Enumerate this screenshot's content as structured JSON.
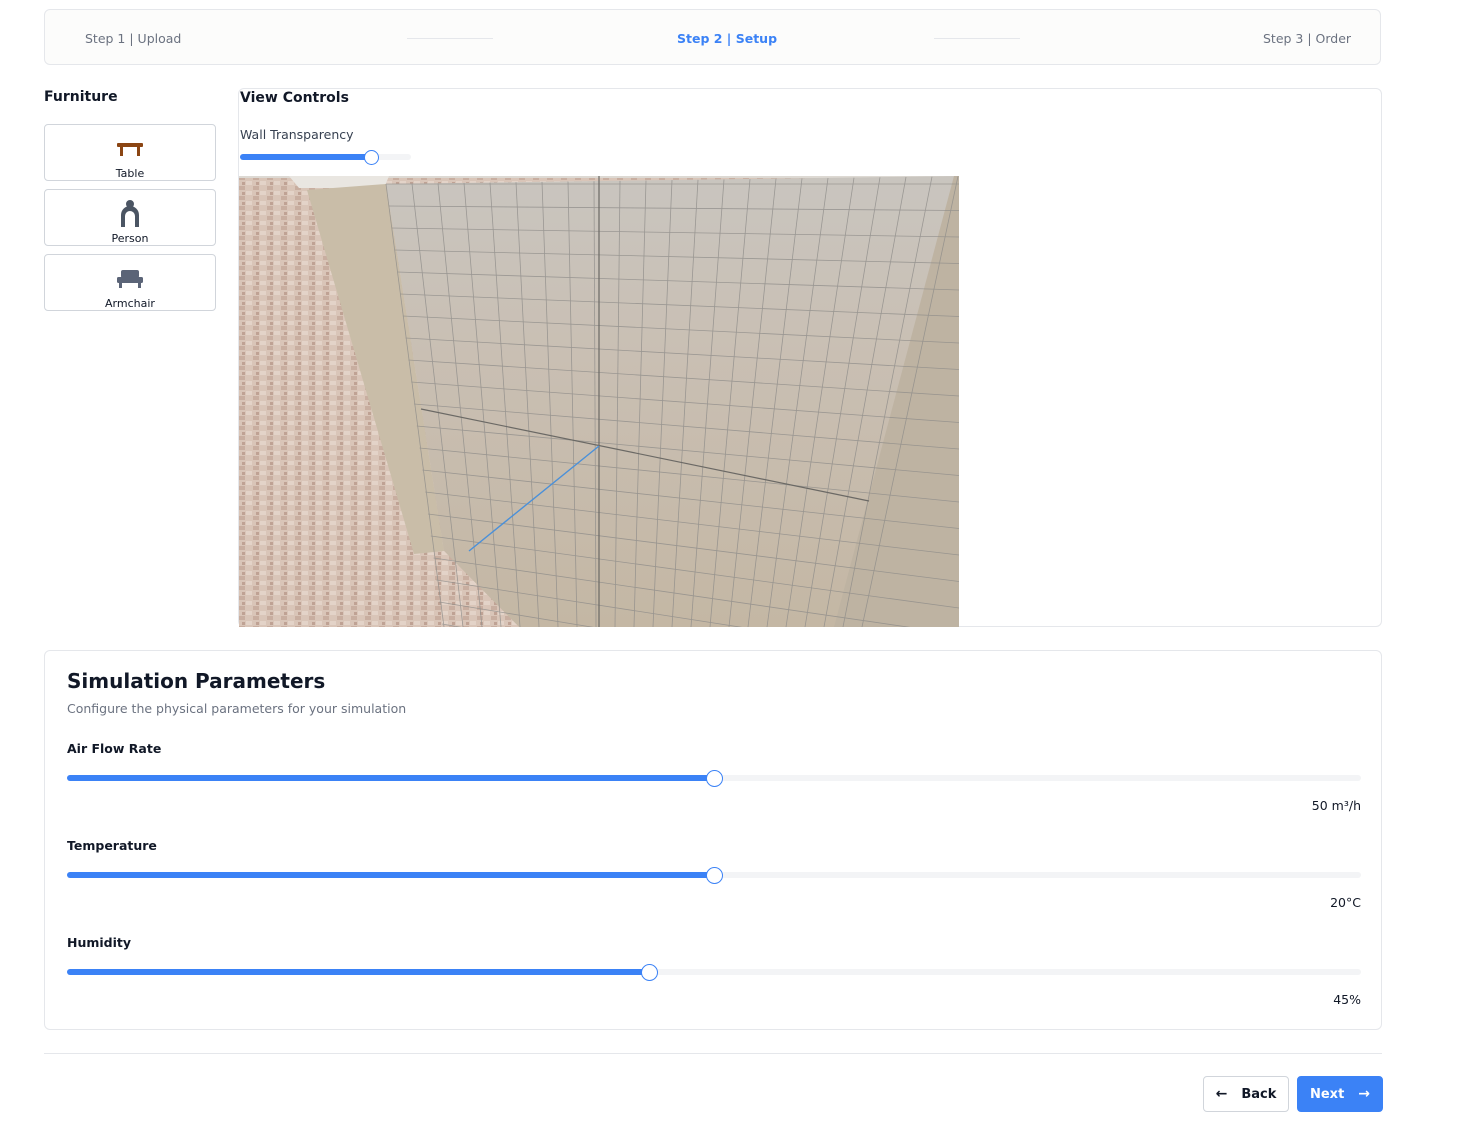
{
  "stepper": {
    "steps": [
      {
        "label": "Step 1 | Upload",
        "state": "done"
      },
      {
        "label": "Step 2 | Setup",
        "state": "active"
      },
      {
        "label": "Step 3 | Order",
        "state": "pending"
      }
    ]
  },
  "furniture": {
    "title": "Furniture",
    "items": [
      {
        "label": "Table",
        "icon": "table-icon",
        "color": "#8b4513"
      },
      {
        "label": "Person",
        "icon": "person-icon",
        "color": "#4b5563"
      },
      {
        "label": "Armchair",
        "icon": "armchair-icon",
        "color": "#5b6477"
      }
    ]
  },
  "view_controls": {
    "title": "View Controls",
    "wall_transparency": {
      "label": "Wall Transparency",
      "fraction": 0.77
    }
  },
  "simulation": {
    "title": "Simulation Parameters",
    "subtitle": "Configure the physical parameters for your simulation",
    "params": [
      {
        "label": "Air Flow Rate",
        "value_text": "50 m³/h",
        "fraction": 0.5
      },
      {
        "label": "Temperature",
        "value_text": "20°C",
        "fraction": 0.5
      },
      {
        "label": "Humidity",
        "value_text": "45%",
        "fraction": 0.45
      }
    ]
  },
  "footer": {
    "back_label": "Back",
    "next_label": "Next"
  },
  "colors": {
    "accent": "#3b82f6",
    "border": "#e5e7eb",
    "muted_text": "#6b7280"
  }
}
